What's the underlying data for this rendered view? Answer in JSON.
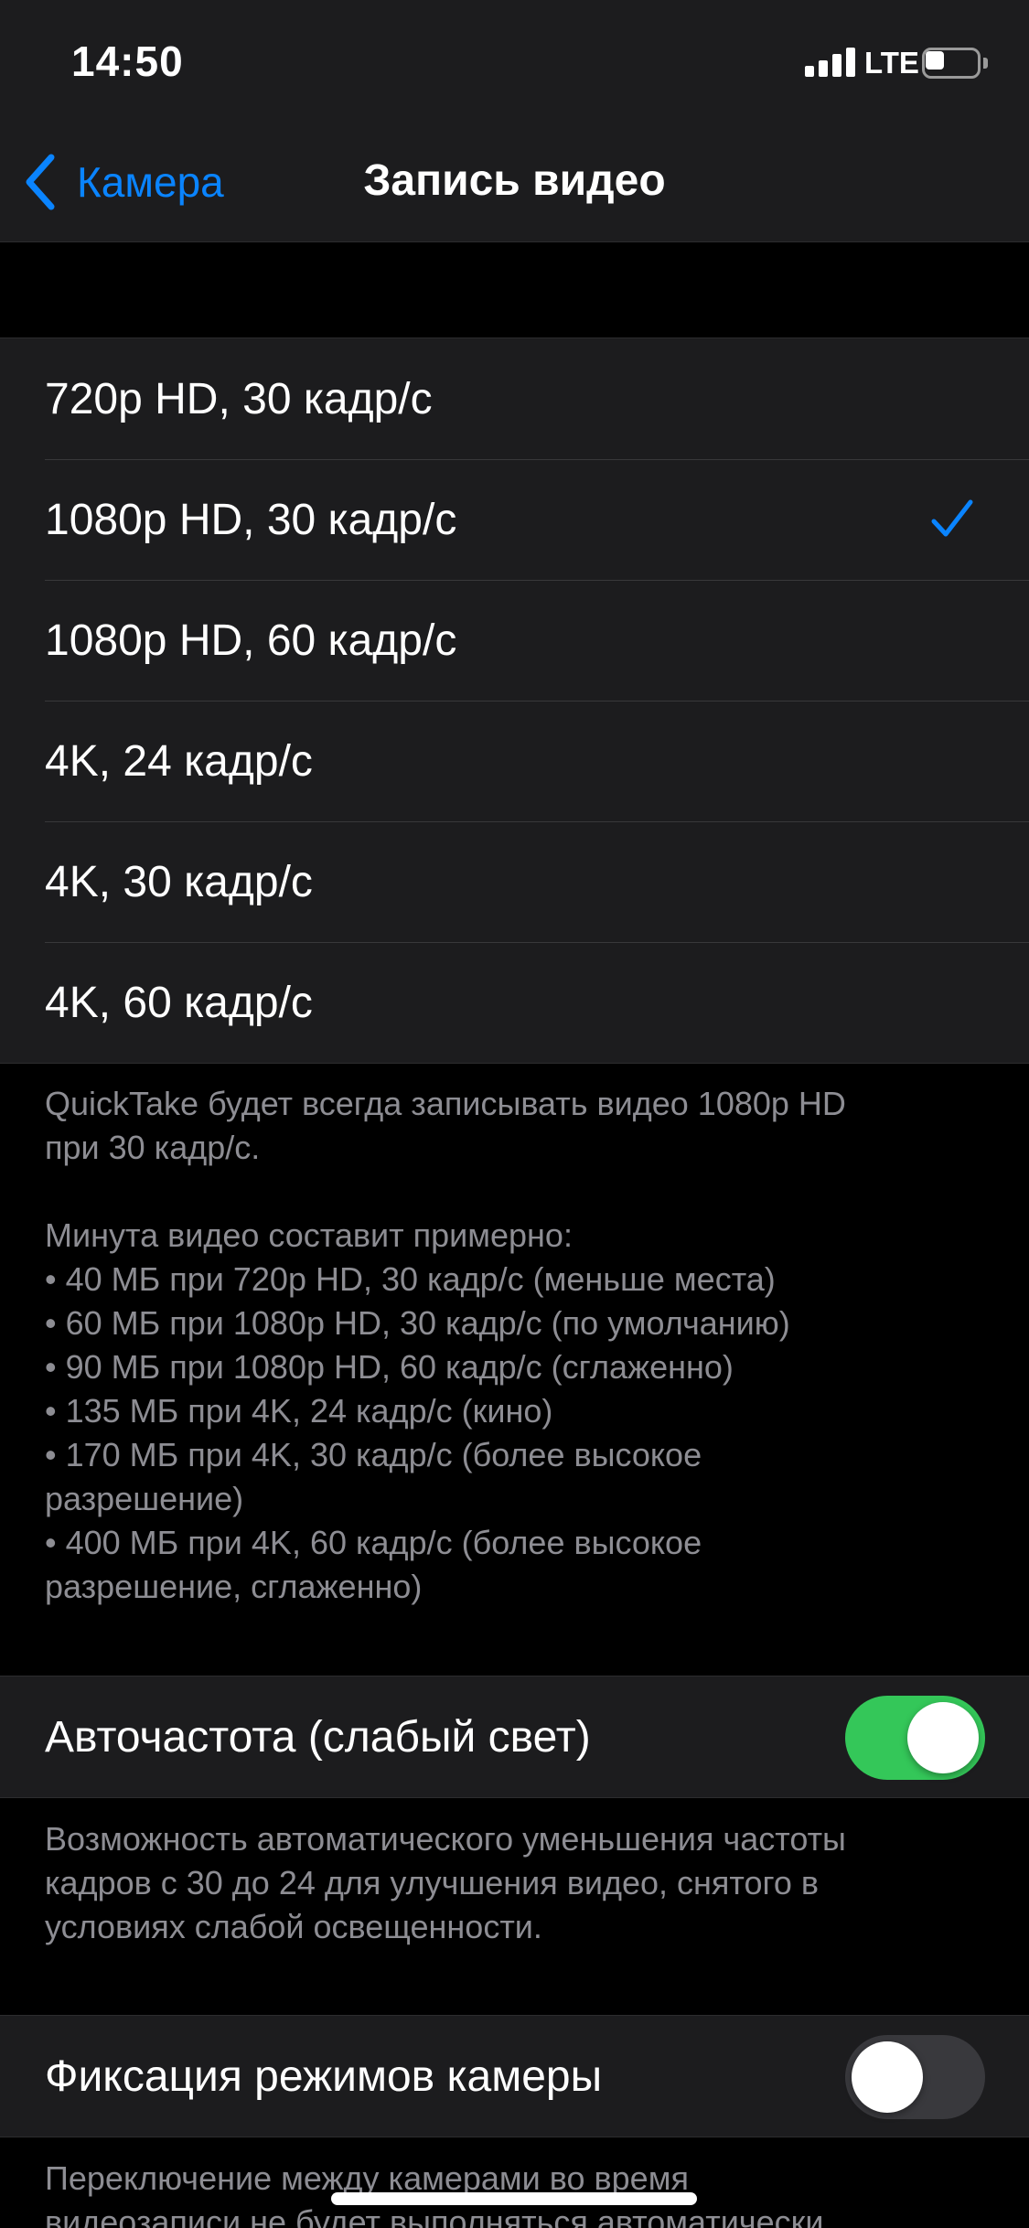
{
  "status_bar": {
    "time": "14:50",
    "network": "LTE"
  },
  "nav": {
    "back_label": "Камера",
    "title": "Запись видео"
  },
  "video_formats": [
    {
      "label": "720p HD, 30 кадр/с",
      "selected": false
    },
    {
      "label": "1080p HD, 30 кадр/с",
      "selected": true
    },
    {
      "label": "1080p HD, 60 кадр/с",
      "selected": false
    },
    {
      "label": "4K, 24 кадр/с",
      "selected": false
    },
    {
      "label": "4K, 30 кадр/с",
      "selected": false
    },
    {
      "label": "4K, 60 кадр/с",
      "selected": false
    }
  ],
  "format_footer": {
    "quicktake_lines": [
      "QuickTake будет всегда записывать видео 1080p HD",
      "при 30 кадр/с."
    ],
    "size_lines": [
      "Минута видео составит примерно:",
      "• 40 МБ при 720p HD, 30 кадр/с (меньше места)",
      "• 60 МБ при 1080p HD, 30 кадр/с (по умолчанию)",
      "• 90 МБ при 1080p HD, 60 кадр/с (сглаженно)",
      "• 135 МБ при 4K, 24 кадр/с (кино)",
      "• 170 МБ при 4K, 30 кадр/с (более высокое",
      "разрешение)",
      "• 400 МБ при 4K, 60 кадр/с (более высокое",
      "разрешение, сглаженно)"
    ]
  },
  "auto_fps": {
    "label": "Автočастота (слабый свет)",
    "enabled": true,
    "footer_lines": [
      "Возможность автоматического уменьшения частоты",
      "кадров с 30 до 24 для улучшения видео, снятого в",
      "условиях слабой освещенности."
    ]
  },
  "lock_camera": {
    "label": "Фиксация режимов камеры",
    "enabled": false,
    "footer_lines": [
      "Переключение между камерами во время",
      "видеозаписи не будет выполняться автоматически."
    ]
  },
  "colors": {
    "accent": "#0a84ff",
    "toggle_on": "#34c759",
    "toggle_off": "#39393d",
    "secondary_text": "#8d8d93"
  },
  "icons": {
    "back": "chevron-left-icon",
    "selected": "checkmark-icon",
    "signal": "signal-bars-icon",
    "battery": "battery-icon"
  }
}
